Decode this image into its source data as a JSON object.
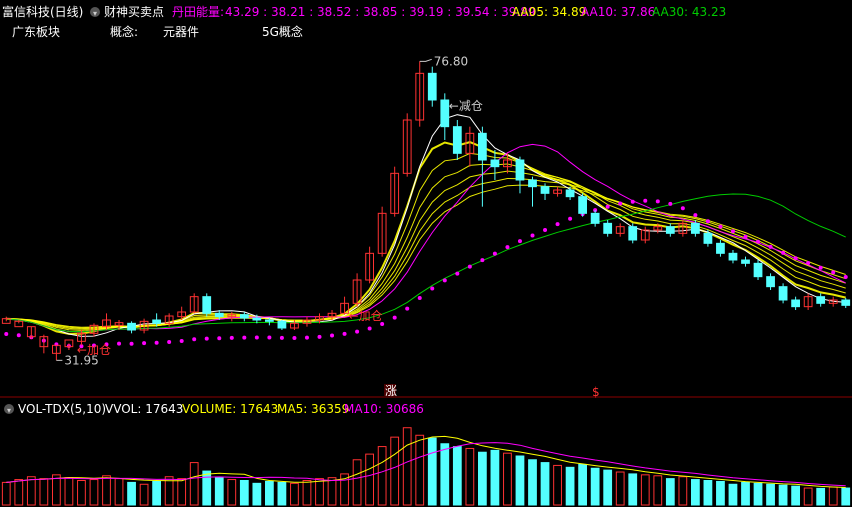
{
  "header": {
    "title": "富信科技(日线)",
    "indicator_name": "财神买卖点",
    "energy_label": "丹田能量:",
    "energy_values": "43.29 : 38.21 : 38.52 : 38.85 : 39.19 : 39.54 : 39.89",
    "aa05": "AA05: 34.89",
    "aa10": "AA10: 37.86",
    "aa30": "AA30: 43.23"
  },
  "info": {
    "sector": "广东板块",
    "concept_label": "概念:",
    "concept1": "元器件",
    "concept2": "5G概念"
  },
  "volume_header": {
    "name": "VOL-TDX(5,10)",
    "vvol": "VVOL: 17643",
    "volume": "VOLUME: 17643",
    "ma5": "MA5: 36359",
    "ma10": "MA10: 30686"
  },
  "colors": {
    "up": "#ff3232",
    "down": "#54ffff",
    "ma_white": "#ffffff",
    "ma_yellow": "#ffff00",
    "ma_magenta": "#ff00ff",
    "ma_green": "#00cc00"
  },
  "chart_data": {
    "type": "candlestick",
    "price_ylim": [
      29,
      80
    ],
    "annotations": {
      "high": "76.80",
      "low": "31.95",
      "reduce": "←减仓",
      "add1": "←加仓",
      "add2": "←加仓",
      "mark_zhang": "涨",
      "mark_s": "$"
    },
    "candles": [
      [
        37.5,
        38.2,
        37.8,
        38.5
      ],
      [
        37.0,
        37.8,
        37.5,
        38.0
      ],
      [
        35.5,
        37.0,
        37.0,
        35.2
      ],
      [
        34.0,
        35.5,
        35.8,
        33.0
      ],
      [
        33.0,
        34.2,
        34.0,
        31.95
      ],
      [
        34.0,
        35.0,
        34.5,
        33.5
      ],
      [
        34.8,
        36.0,
        36.5,
        34.2
      ],
      [
        36.0,
        37.2,
        37.5,
        35.5
      ],
      [
        37.0,
        38.0,
        39.0,
        36.5
      ],
      [
        37.2,
        37.6,
        38.0,
        36.5
      ],
      [
        37.5,
        36.5,
        37.8,
        36.0
      ],
      [
        36.5,
        37.8,
        38.2,
        36.0
      ],
      [
        38.0,
        37.5,
        39.0,
        37.0
      ],
      [
        37.5,
        38.6,
        39.0,
        37.0
      ],
      [
        38.5,
        39.2,
        40.0,
        38.0
      ],
      [
        39.2,
        41.5,
        42.0,
        39.0
      ],
      [
        41.5,
        39.0,
        42.0,
        38.5
      ],
      [
        39.0,
        38.5,
        39.5,
        38.0
      ],
      [
        38.5,
        38.8,
        39.2,
        37.8
      ],
      [
        38.8,
        38.3,
        39.2,
        37.8
      ],
      [
        38.3,
        38.0,
        38.8,
        37.5
      ],
      [
        38.0,
        37.8,
        38.3,
        37.2
      ],
      [
        37.8,
        36.8,
        38.0,
        36.5
      ],
      [
        36.8,
        37.5,
        38.0,
        36.5
      ],
      [
        37.5,
        38.0,
        38.5,
        37.0
      ],
      [
        38.0,
        38.5,
        39.0,
        37.5
      ],
      [
        38.5,
        39.0,
        39.5,
        38.0
      ],
      [
        39.0,
        40.5,
        41.5,
        38.8
      ],
      [
        40.5,
        44.0,
        45.0,
        40.0
      ],
      [
        44.0,
        48.0,
        49.0,
        43.5
      ],
      [
        48.0,
        54.0,
        55.0,
        47.5
      ],
      [
        54.0,
        60.0,
        61.0,
        53.5
      ],
      [
        60.0,
        68.0,
        69.0,
        59.5
      ],
      [
        68.0,
        75.0,
        76.8,
        67.0
      ],
      [
        75.0,
        71.0,
        76.0,
        70.0
      ],
      [
        71.0,
        67.0,
        72.0,
        65.0
      ],
      [
        67.0,
        63.0,
        68.0,
        62.0
      ],
      [
        63.0,
        66.0,
        67.0,
        61.0
      ],
      [
        66.0,
        62.0,
        67.0,
        55.0
      ],
      [
        62.0,
        61.0,
        63.5,
        59.0
      ],
      [
        61.0,
        62.0,
        63.0,
        60.0
      ],
      [
        62.0,
        59.0,
        62.5,
        57.0
      ],
      [
        59.0,
        58.0,
        59.5,
        55.0
      ],
      [
        58.0,
        57.0,
        58.5,
        56.0
      ],
      [
        57.0,
        57.5,
        58.0,
        56.5
      ],
      [
        57.5,
        56.5,
        58.0,
        56.0
      ],
      [
        56.5,
        54.0,
        57.0,
        53.5
      ],
      [
        54.0,
        52.5,
        54.5,
        52.0
      ],
      [
        52.5,
        51.0,
        53.0,
        50.5
      ],
      [
        51.0,
        52.0,
        52.5,
        50.5
      ],
      [
        52.0,
        50.0,
        52.5,
        49.5
      ],
      [
        50.0,
        51.5,
        52.0,
        49.5
      ],
      [
        51.5,
        52.0,
        52.5,
        51.0
      ],
      [
        52.0,
        51.0,
        52.5,
        50.5
      ],
      [
        51.0,
        52.5,
        53.0,
        50.5
      ],
      [
        52.5,
        51.0,
        53.0,
        50.5
      ],
      [
        51.0,
        49.5,
        51.5,
        49.0
      ],
      [
        49.5,
        48.0,
        50.0,
        47.5
      ],
      [
        48.0,
        47.0,
        48.5,
        46.5
      ],
      [
        47.0,
        46.5,
        47.5,
        46.0
      ],
      [
        46.5,
        44.5,
        47.0,
        44.0
      ],
      [
        44.5,
        43.0,
        45.0,
        42.5
      ],
      [
        43.0,
        41.0,
        43.5,
        40.5
      ],
      [
        41.0,
        40.0,
        41.5,
        39.5
      ],
      [
        40.0,
        41.5,
        42.0,
        39.5
      ],
      [
        41.5,
        40.5,
        42.0,
        40.0
      ],
      [
        40.5,
        41.0,
        41.5,
        40.0
      ],
      [
        41.0,
        40.2,
        41.3,
        39.8
      ]
    ],
    "volumes": [
      24000,
      27000,
      30000,
      28000,
      32000,
      29000,
      26000,
      27000,
      31000,
      28000,
      24000,
      22000,
      25000,
      30000,
      28000,
      45000,
      36000,
      29000,
      27000,
      26000,
      23000,
      25000,
      24000,
      23000,
      26000,
      28000,
      29000,
      33000,
      48000,
      54000,
      62000,
      72000,
      82000,
      74000,
      71000,
      65000,
      62000,
      60000,
      56000,
      58000,
      55000,
      52000,
      48000,
      45000,
      42000,
      40000,
      43000,
      39000,
      37000,
      35000,
      33000,
      32000,
      31000,
      28000,
      30000,
      27000,
      26000,
      25000,
      22000,
      24000,
      23000,
      22000,
      21000,
      20000,
      18000,
      17643,
      19000,
      18000
    ]
  }
}
